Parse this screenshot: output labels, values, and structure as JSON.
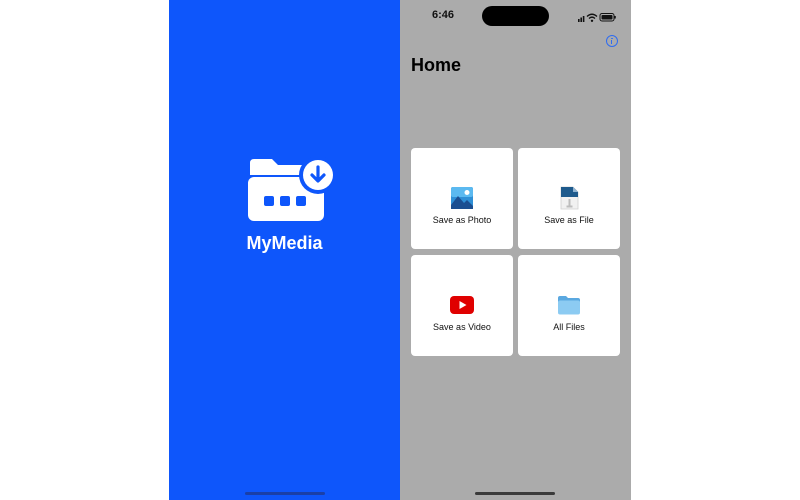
{
  "splash": {
    "app_name": "MyMedia",
    "icon": "folder-download-icon",
    "background_color": "#0e56fb"
  },
  "status_bar": {
    "time": "6:46",
    "icons": [
      "cellular-signal-icon",
      "wifi-icon",
      "battery-icon"
    ]
  },
  "home": {
    "title": "Home",
    "info_icon": "info-icon",
    "background_color": "#ababab",
    "tiles": [
      {
        "label": "Save as Photo",
        "icon": "photo-icon"
      },
      {
        "label": "Save as File",
        "icon": "file-icon"
      },
      {
        "label": "Save as Video",
        "icon": "video-play-icon"
      },
      {
        "label": "All Files",
        "icon": "folder-icon"
      }
    ]
  }
}
